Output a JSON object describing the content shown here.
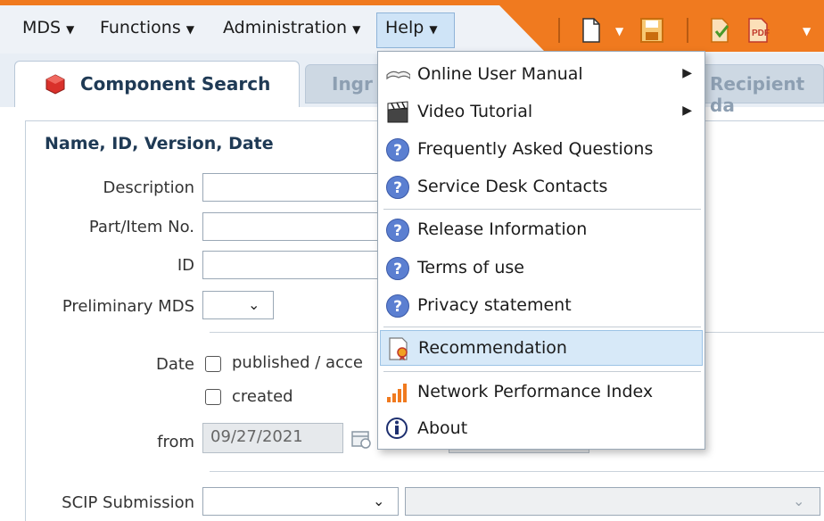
{
  "menubar": {
    "items": [
      "MDS",
      "Functions",
      "Administration",
      "Help"
    ],
    "accent_color": "#f07a1f"
  },
  "tabs": {
    "active": "Component Search",
    "inactive_1": "Ingr",
    "inactive_2": "Recipient da"
  },
  "form": {
    "section_title": "Name, ID, Version, Date",
    "description_label": "Description",
    "part_label": "Part/Item No.",
    "id_label": "ID",
    "preliminary_label": "Preliminary MDS",
    "date_label": "Date",
    "published_label": "published / acce",
    "created_label": "created",
    "from_label": "from",
    "from_value": "09/27/2021",
    "scip_label": "SCIP Submission"
  },
  "help_menu": {
    "items": [
      {
        "label": "Online User Manual",
        "icon": "book-icon",
        "submenu": true
      },
      {
        "label": "Video Tutorial",
        "icon": "clapperboard-icon",
        "submenu": true
      },
      {
        "label": "Frequently Asked Questions",
        "icon": "question-icon"
      },
      {
        "label": "Service Desk Contacts",
        "icon": "question-icon"
      },
      {
        "label": "Release Information",
        "icon": "question-icon"
      },
      {
        "label": "Terms of use",
        "icon": "question-icon"
      },
      {
        "label": "Privacy statement",
        "icon": "question-icon"
      },
      {
        "label": "Recommendation",
        "icon": "certificate-icon",
        "highlighted": true
      },
      {
        "label": "Network Performance Index",
        "icon": "signal-bars-icon"
      },
      {
        "label": "About",
        "icon": "info-icon"
      }
    ]
  }
}
